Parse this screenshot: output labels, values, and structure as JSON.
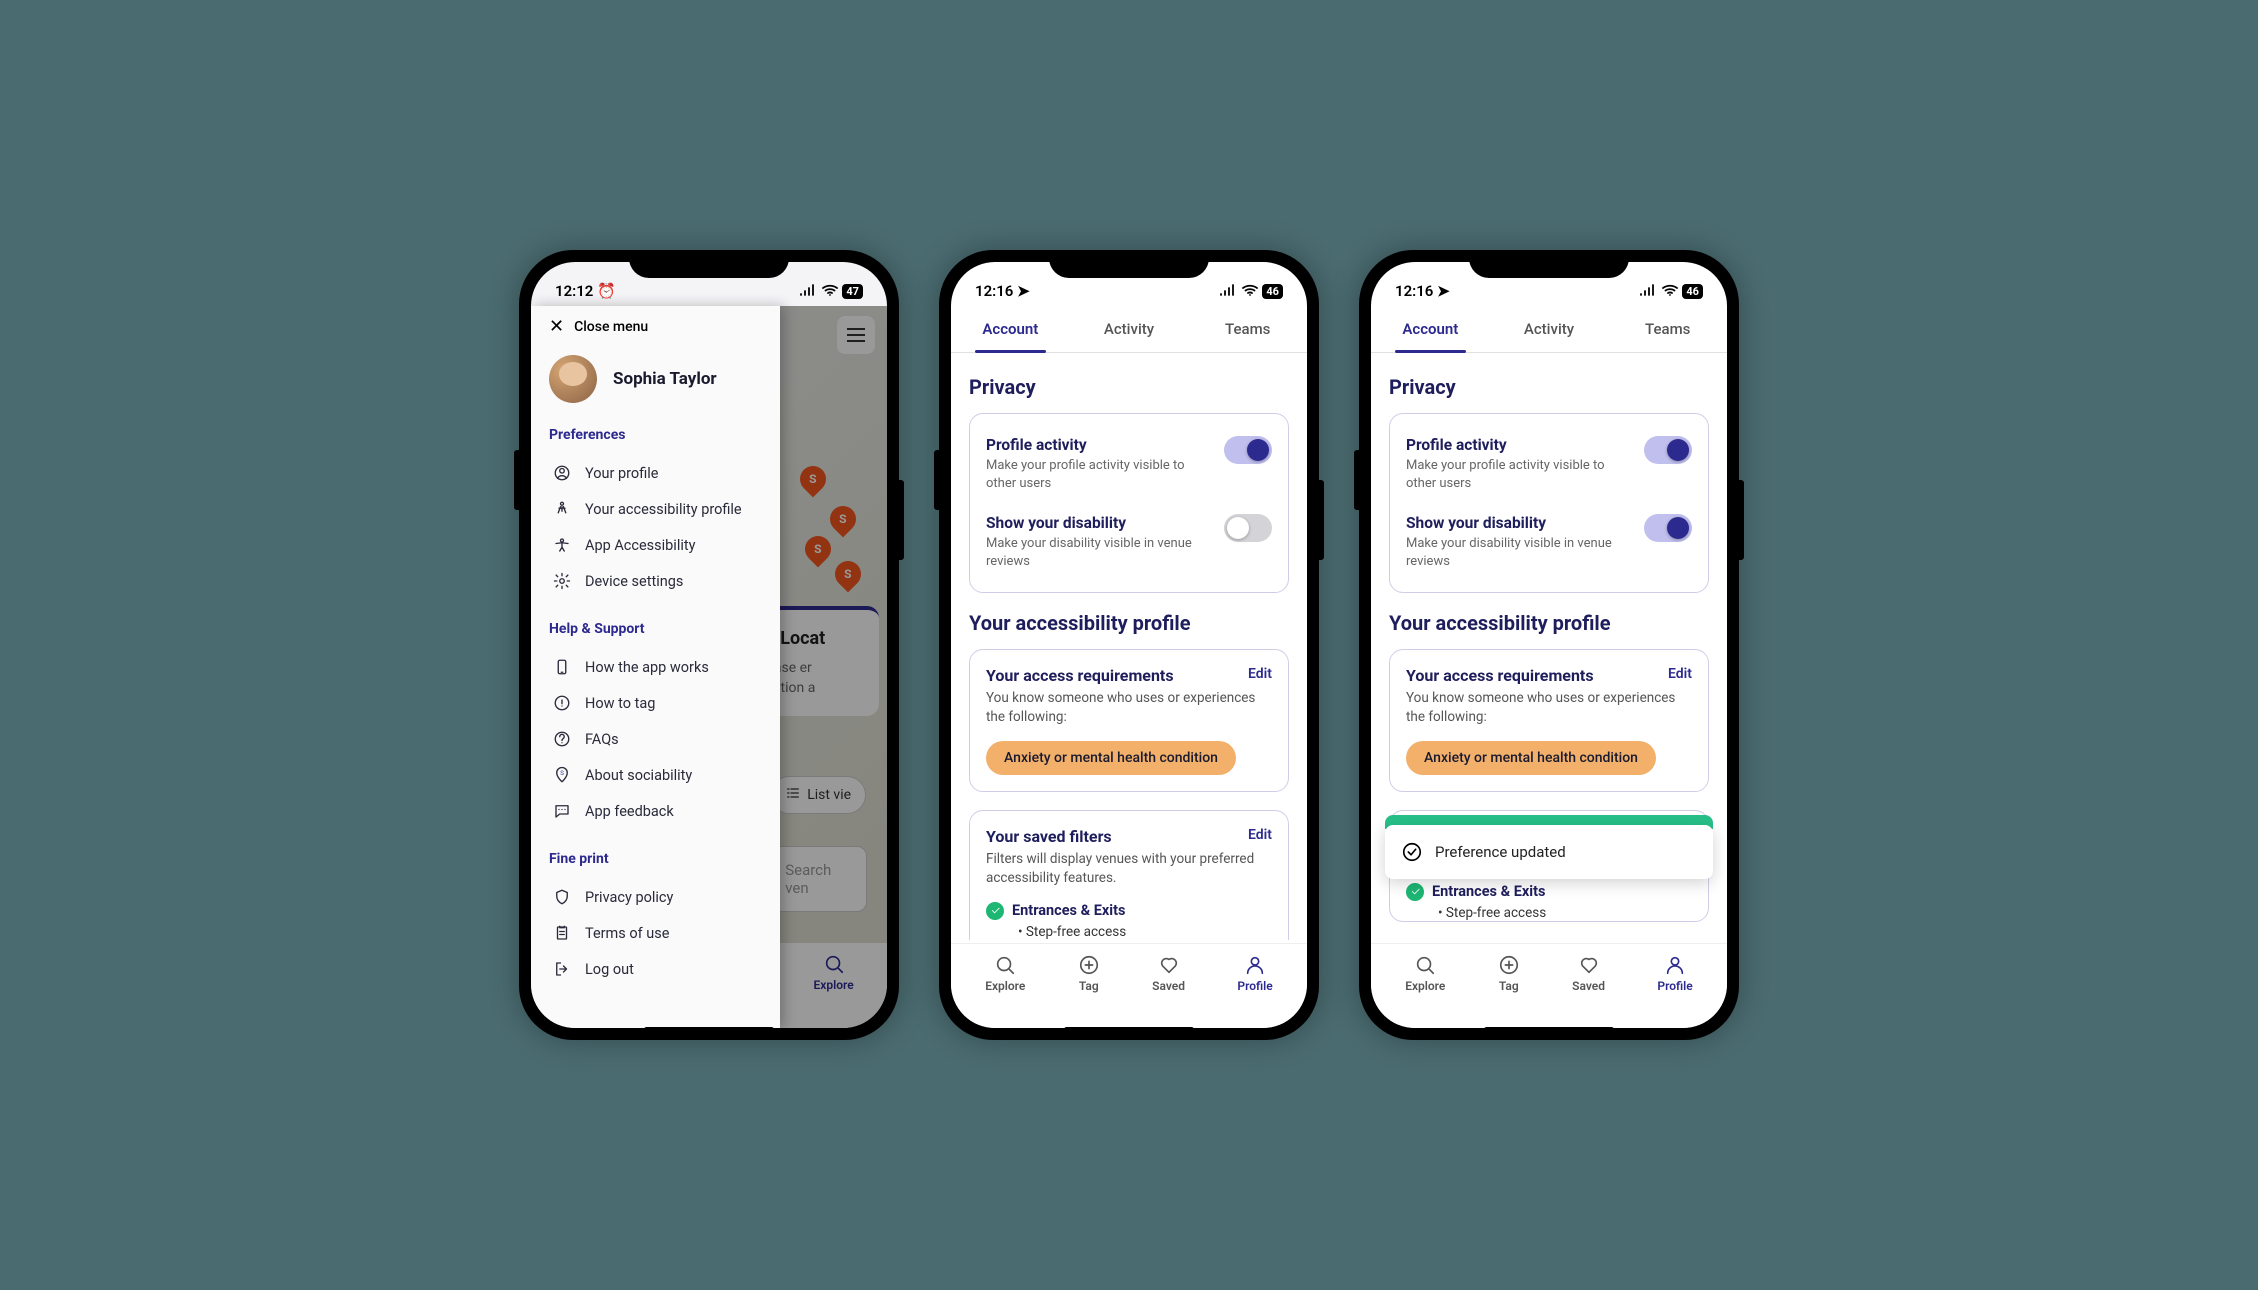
{
  "phone1": {
    "status": {
      "time": "12:12",
      "battery": "47"
    },
    "closeMenu": "Close menu",
    "profileName": "Sophia Taylor",
    "sections": {
      "preferences": {
        "heading": "Preferences",
        "items": [
          "Your profile",
          "Your accessibility profile",
          "App Accessibility",
          "Device settings"
        ]
      },
      "help": {
        "heading": "Help & Support",
        "items": [
          "How the app works",
          "How to tag",
          "FAQs",
          "About sociability",
          "App feedback"
        ]
      },
      "fineprint": {
        "heading": "Fine print",
        "items": [
          "Privacy policy",
          "Terms of use",
          "Log out"
        ]
      }
    },
    "map": {
      "locatTitle": "Locat",
      "locatDesc": "Please er\nlocation a",
      "listView": "List vie",
      "searchPlaceholder": "Search ven"
    },
    "bottomNav": {
      "explore": "Explore"
    }
  },
  "phone2": {
    "status": {
      "time": "12:16",
      "battery": "46"
    },
    "tabs": [
      "Account",
      "Activity",
      "Teams"
    ],
    "privacyHeading": "Privacy",
    "toggles": {
      "profileActivity": {
        "title": "Profile activity",
        "desc": "Make your profile activity visible to other users",
        "on": true
      },
      "showDisability": {
        "title": "Show your disability",
        "desc": "Make your disability visible in venue reviews",
        "on": false
      }
    },
    "accessProfileHeading": "Your accessibility profile",
    "requirements": {
      "title": "Your access requirements",
      "edit": "Edit",
      "sub": "You know someone who uses or experiences the following:",
      "pill": "Anxiety or mental health condition"
    },
    "filters": {
      "title": "Your saved filters",
      "edit": "Edit",
      "sub": "Filters will display venues with your preferred accessibility features.",
      "item": "Entrances & Exits",
      "subitem": "Step-free access"
    },
    "nav": {
      "explore": "Explore",
      "tag": "Tag",
      "saved": "Saved",
      "profile": "Profile"
    }
  },
  "phone3": {
    "status": {
      "time": "12:16",
      "battery": "46"
    },
    "tabs": [
      "Account",
      "Activity",
      "Teams"
    ],
    "privacyHeading": "Privacy",
    "toggles": {
      "profileActivity": {
        "title": "Profile activity",
        "desc": "Make your profile activity visible to other users",
        "on": true
      },
      "showDisability": {
        "title": "Show your disability",
        "desc": "Make your disability visible in venue reviews",
        "on": true
      }
    },
    "accessProfileHeading": "Your accessibility profile",
    "requirements": {
      "title": "Your access requirements",
      "edit": "Edit",
      "sub": "You know someone who uses or experiences the following:",
      "pill": "Anxiety or mental health condition"
    },
    "filters": {
      "item": "Entrances & Exits",
      "subitem": "Step-free access"
    },
    "toast": "Preference updated",
    "nav": {
      "explore": "Explore",
      "tag": "Tag",
      "saved": "Saved",
      "profile": "Profile"
    }
  }
}
